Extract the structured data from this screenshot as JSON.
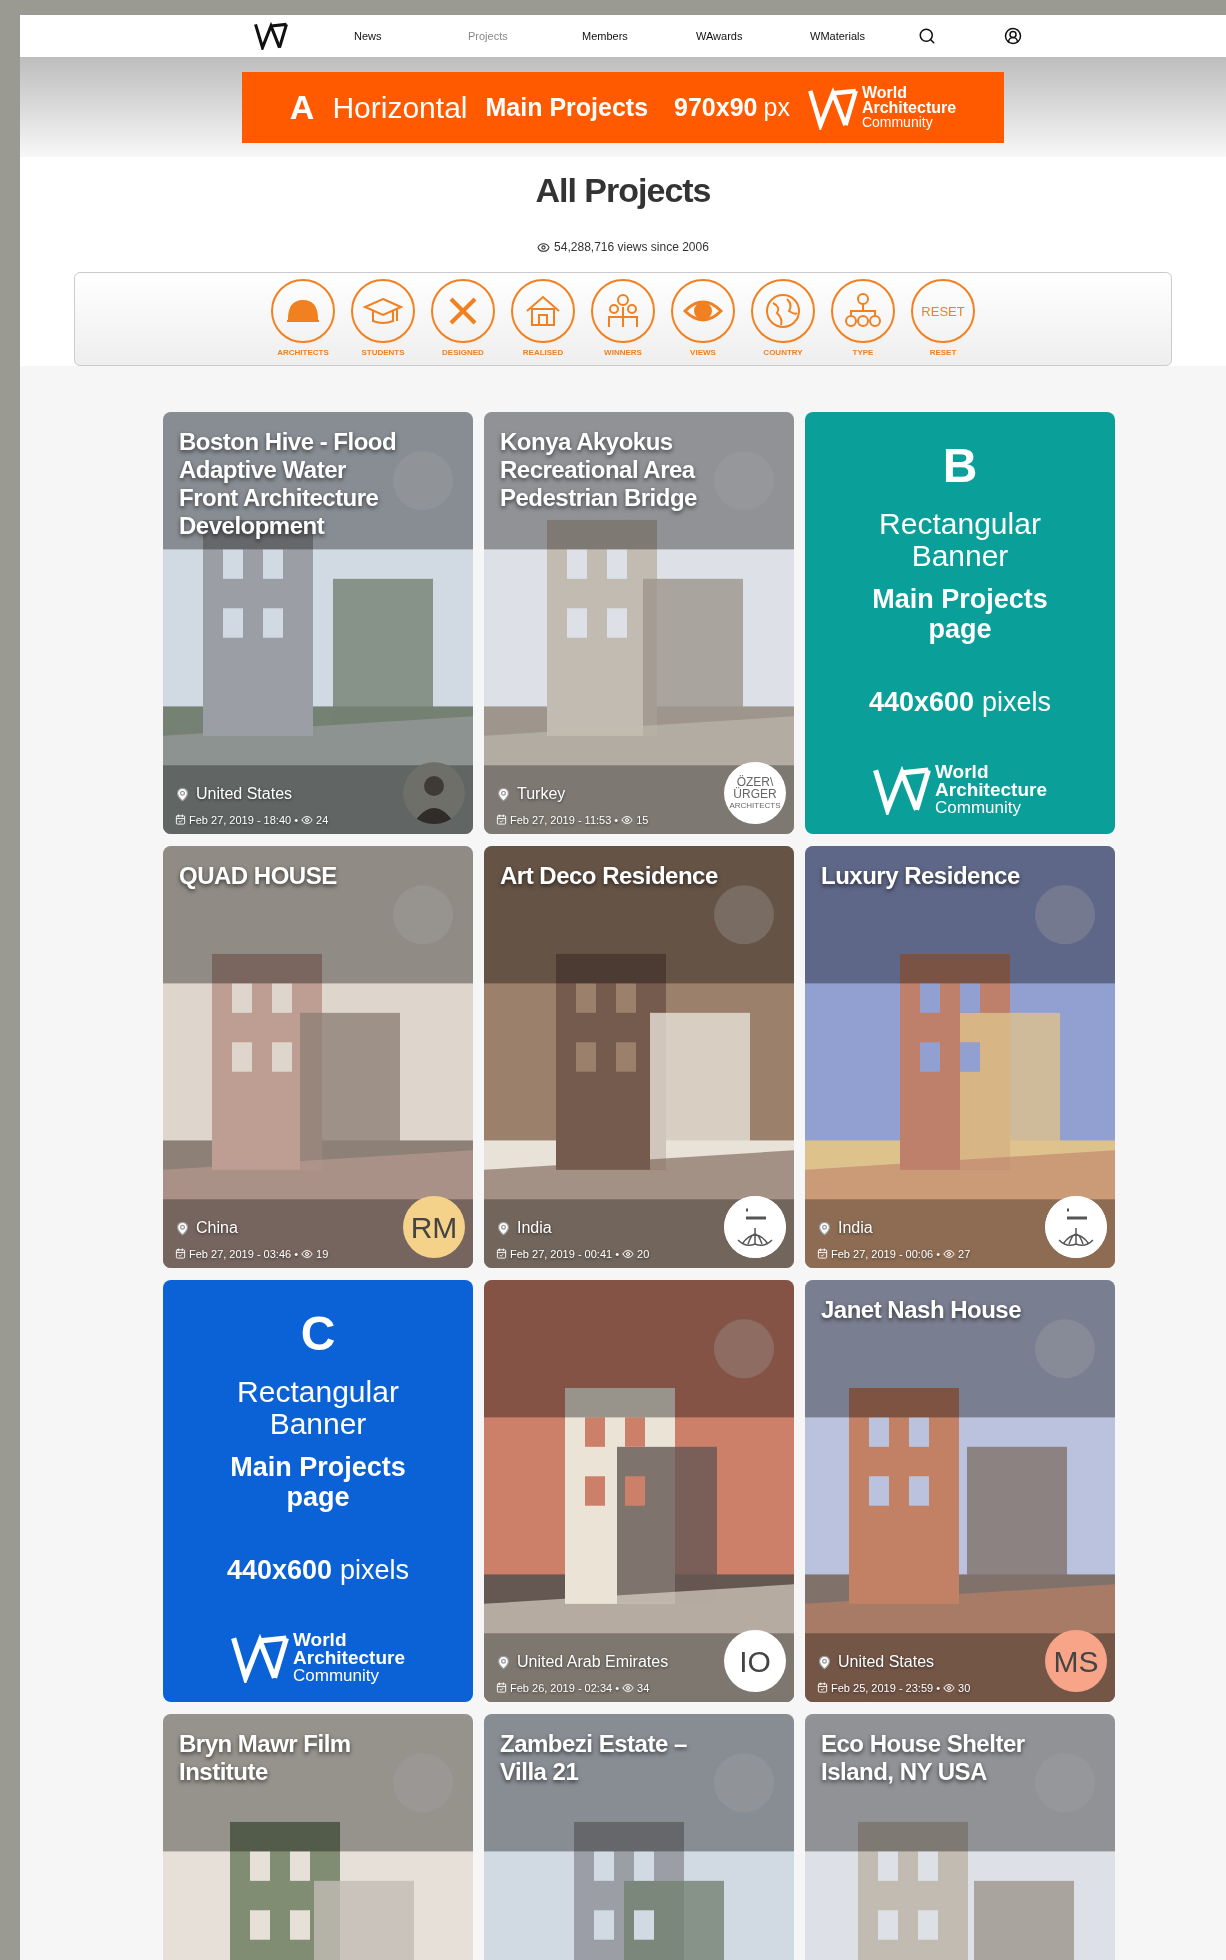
{
  "nav": {
    "items": [
      {
        "label": "News",
        "selected": false
      },
      {
        "label": "Projects",
        "selected": true
      },
      {
        "label": "Members",
        "selected": false
      },
      {
        "label": "WAwards",
        "selected": false
      },
      {
        "label": "WMaterials",
        "selected": false
      }
    ]
  },
  "top_banner": {
    "letter": "A",
    "format": "Horizontal",
    "page": "Main Projects",
    "size": "970x90",
    "unit": "px",
    "logo": [
      "World",
      "Architecture",
      "Community"
    ]
  },
  "title": "All Projects",
  "views": "54,288,716 views since 2006",
  "filters": [
    {
      "kind": "helmet",
      "label": "ARCHITECTS"
    },
    {
      "kind": "cap",
      "label": "STUDENTS"
    },
    {
      "kind": "tools",
      "label": "DESIGNED"
    },
    {
      "kind": "house",
      "label": "REALISED"
    },
    {
      "kind": "people",
      "label": "WINNERS"
    },
    {
      "kind": "eye",
      "label": "VIEWS"
    },
    {
      "kind": "globe",
      "label": "COUNTRY"
    },
    {
      "kind": "tree",
      "label": "TYPE"
    },
    {
      "kind": "text",
      "text": "RESET",
      "label": "RESET"
    }
  ],
  "cards": [
    {
      "kind": "project",
      "title": "Boston Hive - Flood Adaptive Water Front Architecture Development",
      "country": "United States",
      "date": "Feb 27, 2019 - 18:40 •",
      "views": "24"
    },
    {
      "kind": "project",
      "title": "Konya Akyokus Recreational Area Pedestrian Bridge",
      "country": "Turkey",
      "date": "Feb 27, 2019 - 11:53 •",
      "views": "15",
      "avatar": {
        "kind": "wordmark",
        "lines": [
          "ÖZER\\",
          "ÜRGER",
          "ARCHITECTS"
        ]
      }
    },
    {
      "kind": "ad",
      "letter": "B",
      "format": "Rectangular Banner",
      "page": "Main Projects page",
      "size": "440x600",
      "unit": "pixels",
      "logo": [
        "World",
        "Architecture",
        "Community"
      ],
      "color": "#0a9f98"
    },
    {
      "kind": "project",
      "title": "QUAD HOUSE",
      "country": "China",
      "date": "Feb 27, 2019 - 03:46 •",
      "views": "19",
      "avatar": {
        "kind": "initials",
        "text": "RM",
        "color": "#f5d28a"
      }
    },
    {
      "kind": "project",
      "title": "Art Deco Residence",
      "country": "India",
      "date": "Feb 27, 2019 - 00:41 •",
      "views": "20",
      "avatar": {
        "kind": "lotus"
      }
    },
    {
      "kind": "project",
      "title": "Luxury Residence",
      "country": "India",
      "date": "Feb 27, 2019 - 00:06 •",
      "views": "27",
      "avatar": {
        "kind": "lotus"
      }
    },
    {
      "kind": "ad",
      "letter": "C",
      "format": "Rectangular Banner",
      "page": "Main Projects page",
      "size": "440x600",
      "unit": "pixels",
      "logo": [
        "World",
        "Architecture",
        "Community"
      ],
      "color": "#0a62d6"
    },
    {
      "kind": "project",
      "country": "United Arab Emirates",
      "date": "Feb 26, 2019 - 02:34 •",
      "views": "34",
      "avatar": {
        "kind": "initials",
        "text": "IO",
        "color": "#ffffff"
      }
    },
    {
      "kind": "project",
      "title": "Janet Nash House",
      "country": "United States",
      "date": "Feb 25, 2019 - 23:59 •",
      "views": "30",
      "avatar": {
        "kind": "initials",
        "text": "MS",
        "color": "#f7a488"
      }
    },
    {
      "kind": "project",
      "title": "Bryn Mawr Film Institute"
    },
    {
      "kind": "project",
      "title": "Zambezi Estate – Villa 21"
    },
    {
      "kind": "project",
      "title": "Eco House Shelter Island, NY USA"
    }
  ]
}
